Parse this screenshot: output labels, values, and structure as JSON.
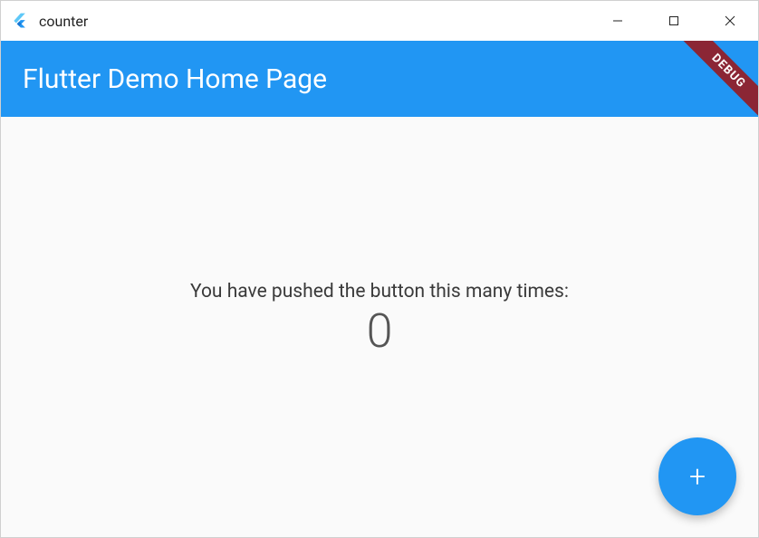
{
  "window": {
    "title": "counter"
  },
  "appbar": {
    "title": "Flutter Demo Home Page",
    "debug_label": "DEBUG"
  },
  "body": {
    "push_text": "You have pushed the button this many times:",
    "count": "0"
  },
  "fab": {
    "label": "+"
  },
  "colors": {
    "primary": "#2196f3",
    "debug_banner": "#8B2635"
  }
}
